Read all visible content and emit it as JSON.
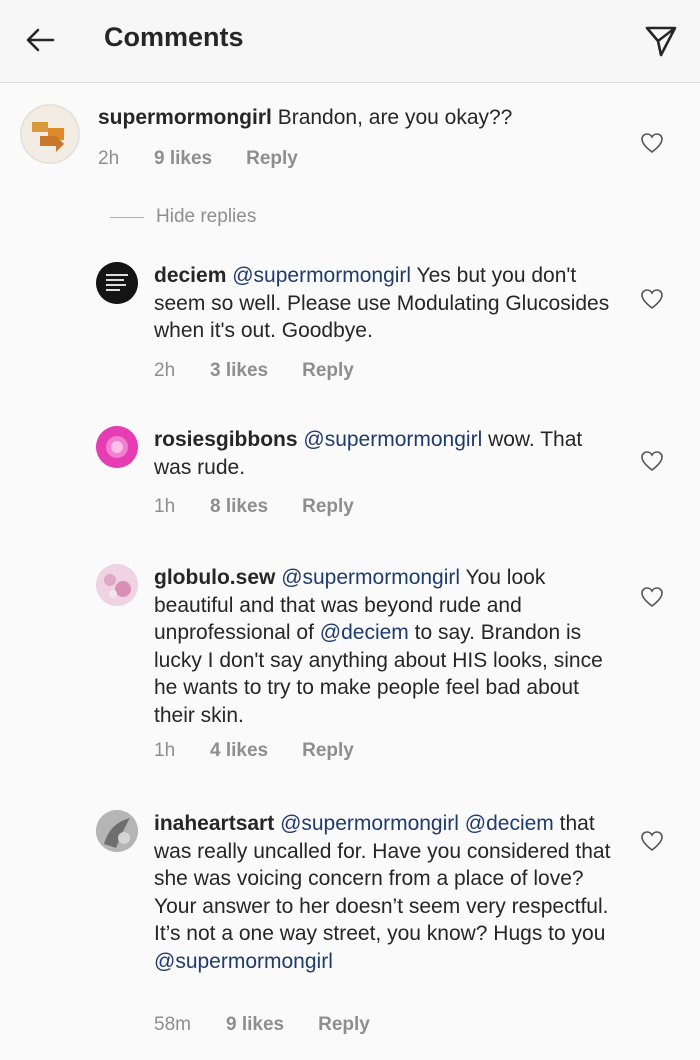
{
  "header": {
    "title": "Comments",
    "back_icon": "arrow-left-icon",
    "send_icon": "paper-plane-icon"
  },
  "hide_replies_label": "Hide replies",
  "comments": [
    {
      "username": "supermormongirl",
      "mention": "",
      "text": " Brandon, are you okay??",
      "time": "2h",
      "likes": "9 likes",
      "reply": "Reply"
    },
    {
      "username": "deciem",
      "mention": "@supermormongirl",
      "text": " Yes but you don't seem so well. Please use Modulating Glucosides when it's out. Goodbye.",
      "time": "2h",
      "likes": "3 likes",
      "reply": "Reply"
    },
    {
      "username": "rosiesgibbons",
      "mention": "@supermormongirl",
      "text": " wow. That was rude.",
      "time": "1h",
      "likes": "8 likes",
      "reply": "Reply"
    },
    {
      "username": "globulo.sew",
      "mention": "@supermormongirl",
      "text_a": " You look beautiful and that was beyond rude and unprofessional of ",
      "mention2": "@deciem",
      "text_b": " to say. Brandon is lucky I don't say anything about HIS looks, since he wants to try to make people feel bad about their skin.",
      "time": "1h",
      "likes": "4 likes",
      "reply": "Reply"
    },
    {
      "username": "inaheartsart",
      "mention": "@supermormongirl",
      "mention2": "@deciem",
      "text_a": " that was really uncalled for. Have you considered that she was voicing concern from a place of love? Your answer to her doesn’t seem very respectful. It’s not a one way street, you know? Hugs to you ",
      "mention3": "@supermormongirl",
      "time": "58m",
      "likes": "9 likes",
      "reply": "Reply"
    }
  ],
  "colors": {
    "text": "#262626",
    "muted": "#8e8e8e",
    "mention": "#1f3b6e",
    "background": "#fafafa"
  }
}
